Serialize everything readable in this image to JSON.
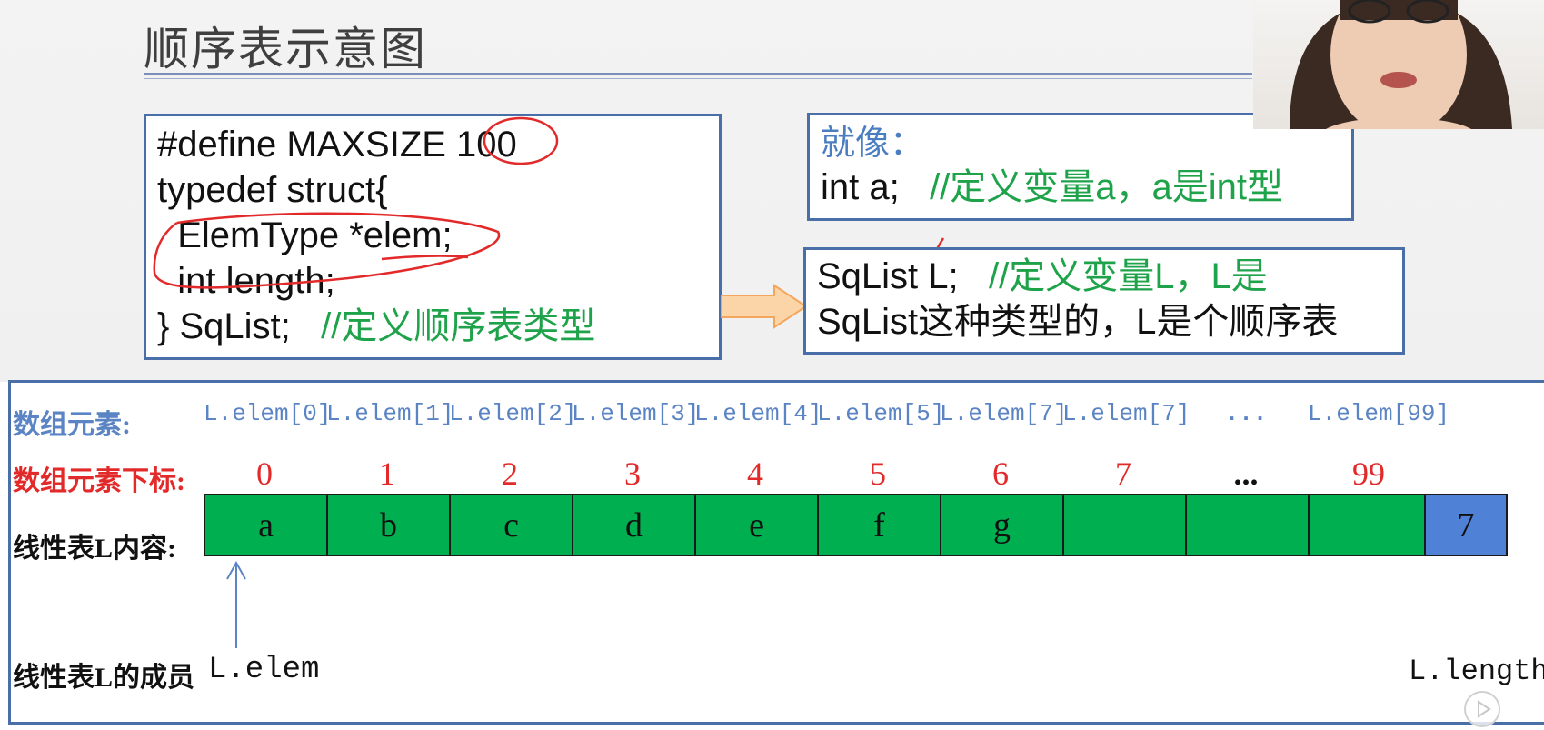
{
  "slide": {
    "title": "顺序表示意图"
  },
  "code": {
    "lines": [
      "#define MAXSIZE 100",
      "typedef struct{",
      "  ElemType *elem;",
      "  int length;",
      "} SqList;   "
    ],
    "comment": "//定义顺序表类型"
  },
  "example": {
    "heading": "就像：",
    "code": "int a;   ",
    "comment": "//定义变量a，a是int型"
  },
  "sqlist_decl": {
    "code": "SqList L;   ",
    "comment_line1": "//定义变量L，L是",
    "comment_line2": "SqList这种类型的，L是个顺序表"
  },
  "diagram": {
    "labels": {
      "elements": "数组元素:",
      "indices": "数组元素下标:",
      "content": "线性表L内容:",
      "members": "线性表L的成员"
    },
    "element_names": [
      "L.elem[0]",
      "L.elem[1]",
      "L.elem[2]",
      "L.elem[3]",
      "L.elem[4]",
      "L.elem[5]",
      "L.elem[7]",
      "L.elem[7]",
      "...",
      "L.elem[99]"
    ],
    "indices": [
      "0",
      "1",
      "2",
      "3",
      "4",
      "5",
      "6",
      "7",
      "...",
      "99"
    ],
    "cells": [
      "a",
      "b",
      "c",
      "d",
      "e",
      "f",
      "g",
      "",
      "",
      ""
    ],
    "length_value": "7",
    "member_elem": "L.elem",
    "member_length": "L.length"
  },
  "colors": {
    "cell_fill": "#00b050",
    "length_fill": "#4f81d6",
    "comment": "#1fa34a",
    "annotation": "#e22a2a",
    "border": "#4a6fa8"
  },
  "icons": [
    "play-icon"
  ]
}
